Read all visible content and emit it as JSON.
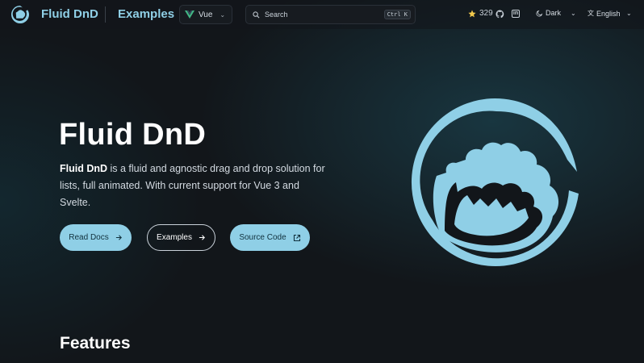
{
  "nav": {
    "brand": "Fluid DnD",
    "examples_link": "Examples",
    "framework_select": {
      "selected": "Vue"
    },
    "search": {
      "placeholder": "Search",
      "shortcut": "Ctrl K"
    },
    "stars_count": "329",
    "theme_label": "Dark",
    "language_label": "English"
  },
  "hero": {
    "title": "Fluid DnD",
    "description_strong": "Fluid DnD",
    "description_rest": " is a fluid and agnostic drag and drop solution for lists, full animated. With current support for Vue 3 and Svelte.",
    "buttons": {
      "read_docs": "Read Docs",
      "examples": "Examples",
      "source_code": "Source Code"
    }
  },
  "sections": {
    "features_heading": "Features"
  },
  "colors": {
    "accent": "#8fcfe6",
    "background": "#12161a",
    "star": "#f2c94c",
    "vue_green": "#42b883"
  },
  "icons": {
    "logo": "fluid-dnd-hand-logo",
    "framework": "vue-icon",
    "search": "search-icon",
    "star": "star-icon",
    "github": "github-icon",
    "linkedin": "linkedin-icon",
    "theme": "moon-icon",
    "language": "translate-icon"
  }
}
